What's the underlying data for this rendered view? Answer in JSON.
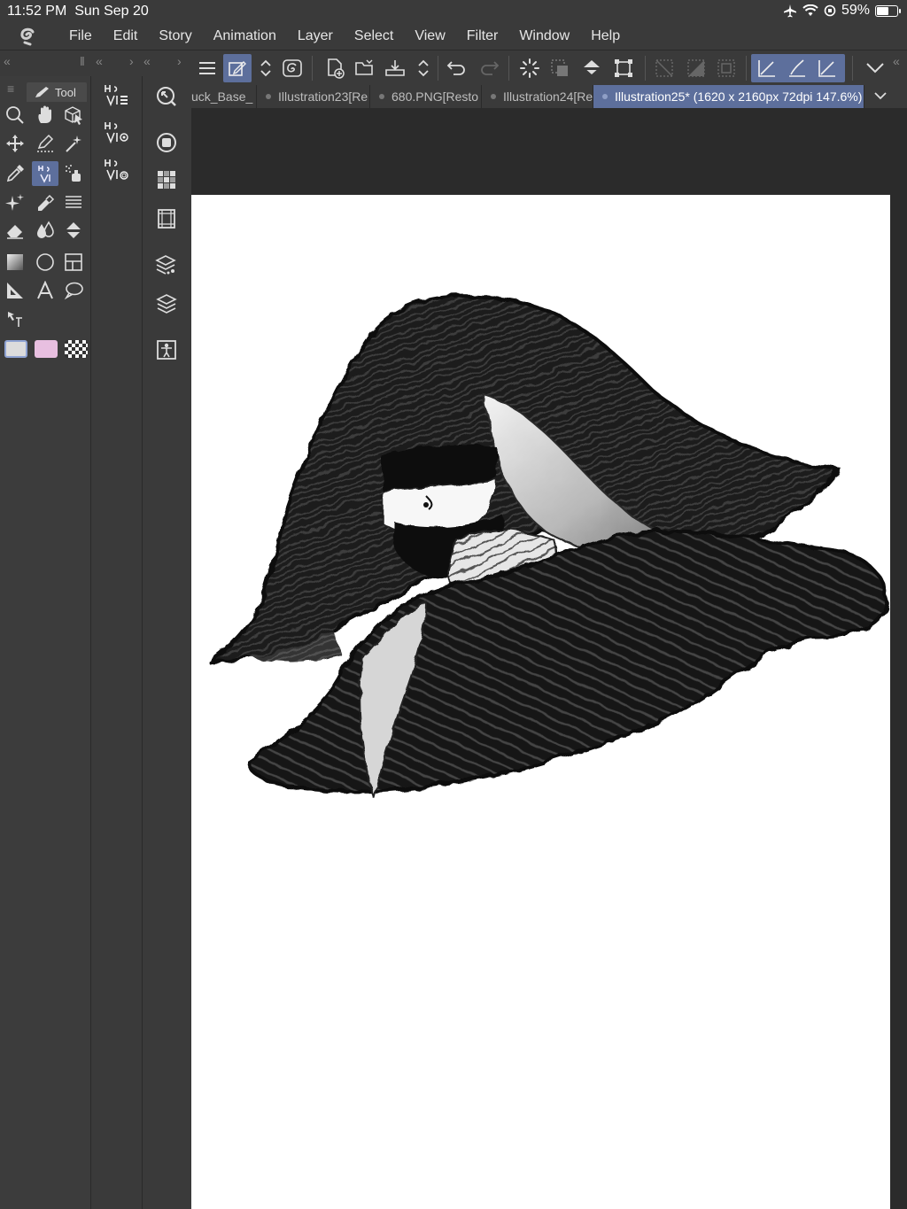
{
  "status": {
    "time": "11:52 PM",
    "date": "Sun Sep 20",
    "battery_text": "59%",
    "battery_level": 0.59
  },
  "menu": [
    "File",
    "Edit",
    "Story",
    "Animation",
    "Layer",
    "Select",
    "View",
    "Filter",
    "Window",
    "Help"
  ],
  "tool_panel": {
    "tab_label": "Tool"
  },
  "colors": {
    "main_color": "#dcdcdc",
    "sub_color": "#e8bfe0",
    "accent": "#5d6f9c"
  },
  "tabs": [
    {
      "label": "uck_Base_",
      "active": false
    },
    {
      "label": "Illustration23[Re",
      "active": false
    },
    {
      "label": "680.PNG[Resto",
      "active": false
    },
    {
      "label": "Illustration24[Re",
      "active": false
    },
    {
      "label": "Illustration25* (1620 x 2160px 72dpi 147.6%)",
      "active": true
    }
  ]
}
